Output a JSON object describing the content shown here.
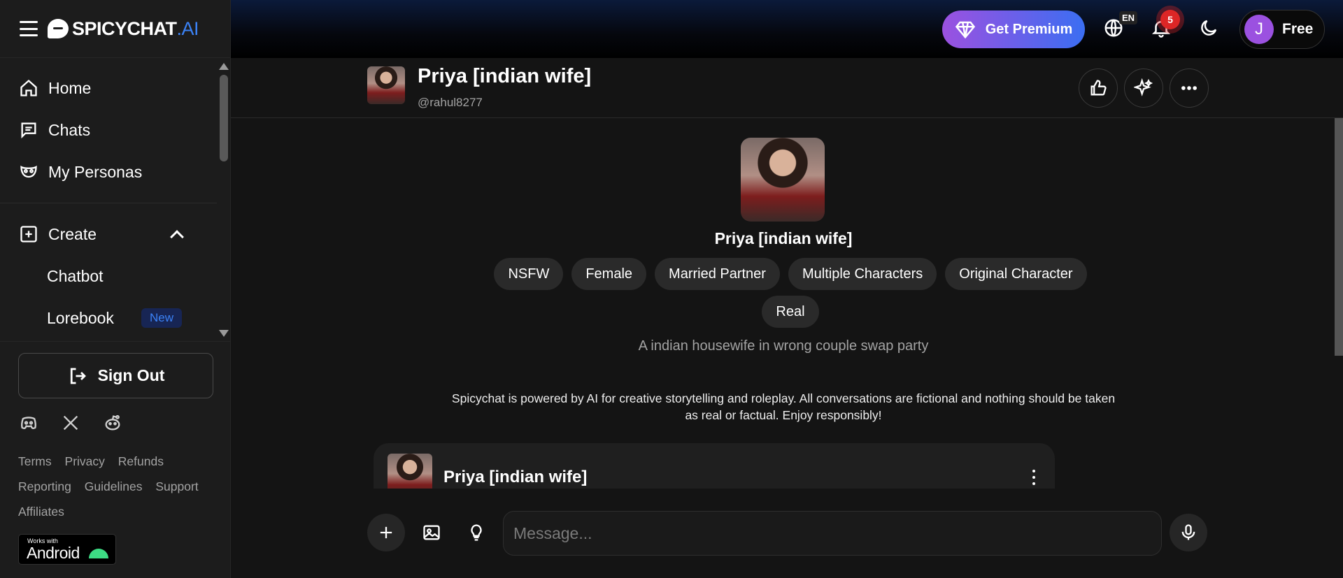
{
  "brand": {
    "name": "SPICYCHAT",
    "suffix": ".AI"
  },
  "sidebar": {
    "nav": [
      {
        "label": "Home",
        "icon": "home-icon"
      },
      {
        "label": "Chats",
        "icon": "chat-icon"
      },
      {
        "label": "My Personas",
        "icon": "mask-icon"
      }
    ],
    "create": {
      "label": "Create",
      "items": [
        {
          "label": "Chatbot"
        },
        {
          "label": "Lorebook",
          "badge": "New"
        }
      ]
    },
    "signout_label": "Sign Out",
    "socials": [
      "discord-icon",
      "x-icon",
      "reddit-icon"
    ],
    "links": [
      "Terms",
      "Privacy",
      "Refunds",
      "Reporting",
      "Guidelines",
      "Support",
      "Affiliates"
    ],
    "android_badge": {
      "small": "Works with",
      "big": "Android"
    }
  },
  "topbar": {
    "premium_label": "Get Premium",
    "language": "EN",
    "notifications": "5",
    "account": {
      "initial": "J",
      "plan": "Free"
    }
  },
  "chat": {
    "name": "Priya [indian wife]",
    "handle": "@rahul8277",
    "tags": [
      "NSFW",
      "Female",
      "Married Partner",
      "Multiple Characters",
      "Original Character",
      "Real"
    ],
    "description": "A indian housewife in wrong couple swap party",
    "disclaimer": "Spicychat is powered by AI for creative storytelling and roleplay. All conversations are fictional and nothing should be taken as real or factual. Enjoy responsibly!",
    "first_message_author": "Priya [indian wife]"
  },
  "composer": {
    "placeholder": "Message..."
  },
  "colors": {
    "accent": "#3b82f6",
    "premium_from": "#9b51e0",
    "premium_to": "#3b6ef2",
    "badge": "#dc2626"
  }
}
